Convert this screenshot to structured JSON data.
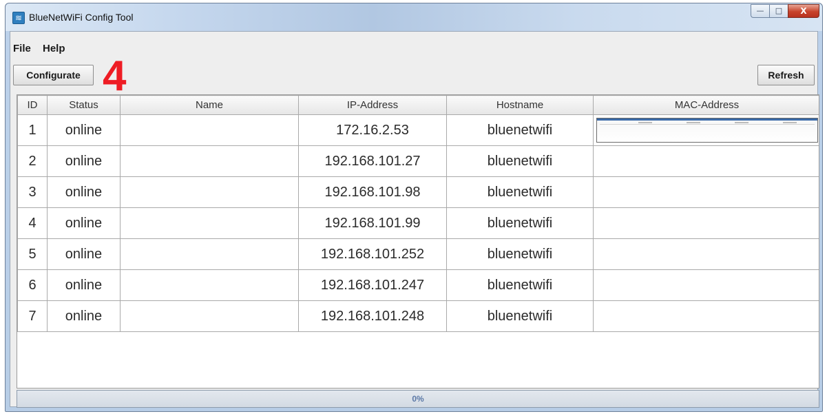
{
  "window": {
    "title": "BlueNetWiFi Config Tool",
    "controls": {
      "minimize": "—",
      "maximize": "□",
      "close": "X"
    }
  },
  "menu": [
    "File",
    "Help"
  ],
  "toolbar": {
    "configurate_label": "Configurate",
    "refresh_label": "Refresh",
    "annotation": "4"
  },
  "table": {
    "columns": [
      "ID",
      "Status",
      "Name",
      "IP-Address",
      "Hostname",
      "MAC-Address"
    ],
    "rows": [
      {
        "id": "1",
        "status": "online",
        "name": "",
        "ip": "172.16.2.53",
        "hostname": "bluenetwifi",
        "mac": ""
      },
      {
        "id": "2",
        "status": "online",
        "name": "",
        "ip": "192.168.101.27",
        "hostname": "bluenetwifi",
        "mac": ""
      },
      {
        "id": "3",
        "status": "online",
        "name": "",
        "ip": "192.168.101.98",
        "hostname": "bluenetwifi",
        "mac": ""
      },
      {
        "id": "4",
        "status": "online",
        "name": "",
        "ip": "192.168.101.99",
        "hostname": "bluenetwifi",
        "mac": ""
      },
      {
        "id": "5",
        "status": "online",
        "name": "",
        "ip": "192.168.101.252",
        "hostname": "bluenetwifi",
        "mac": ""
      },
      {
        "id": "6",
        "status": "online",
        "name": "",
        "ip": "192.168.101.247",
        "hostname": "bluenetwifi",
        "mac": ""
      },
      {
        "id": "7",
        "status": "online",
        "name": "",
        "ip": "192.168.101.248",
        "hostname": "bluenetwifi",
        "mac": ""
      }
    ]
  },
  "progress": {
    "value": 0,
    "label": "0%"
  },
  "colors": {
    "annotation": "#ee1c24",
    "progress_text": "#5b78a6",
    "title_bar": "#c6d8ee"
  },
  "icons": {
    "app": "wifi-icon"
  }
}
